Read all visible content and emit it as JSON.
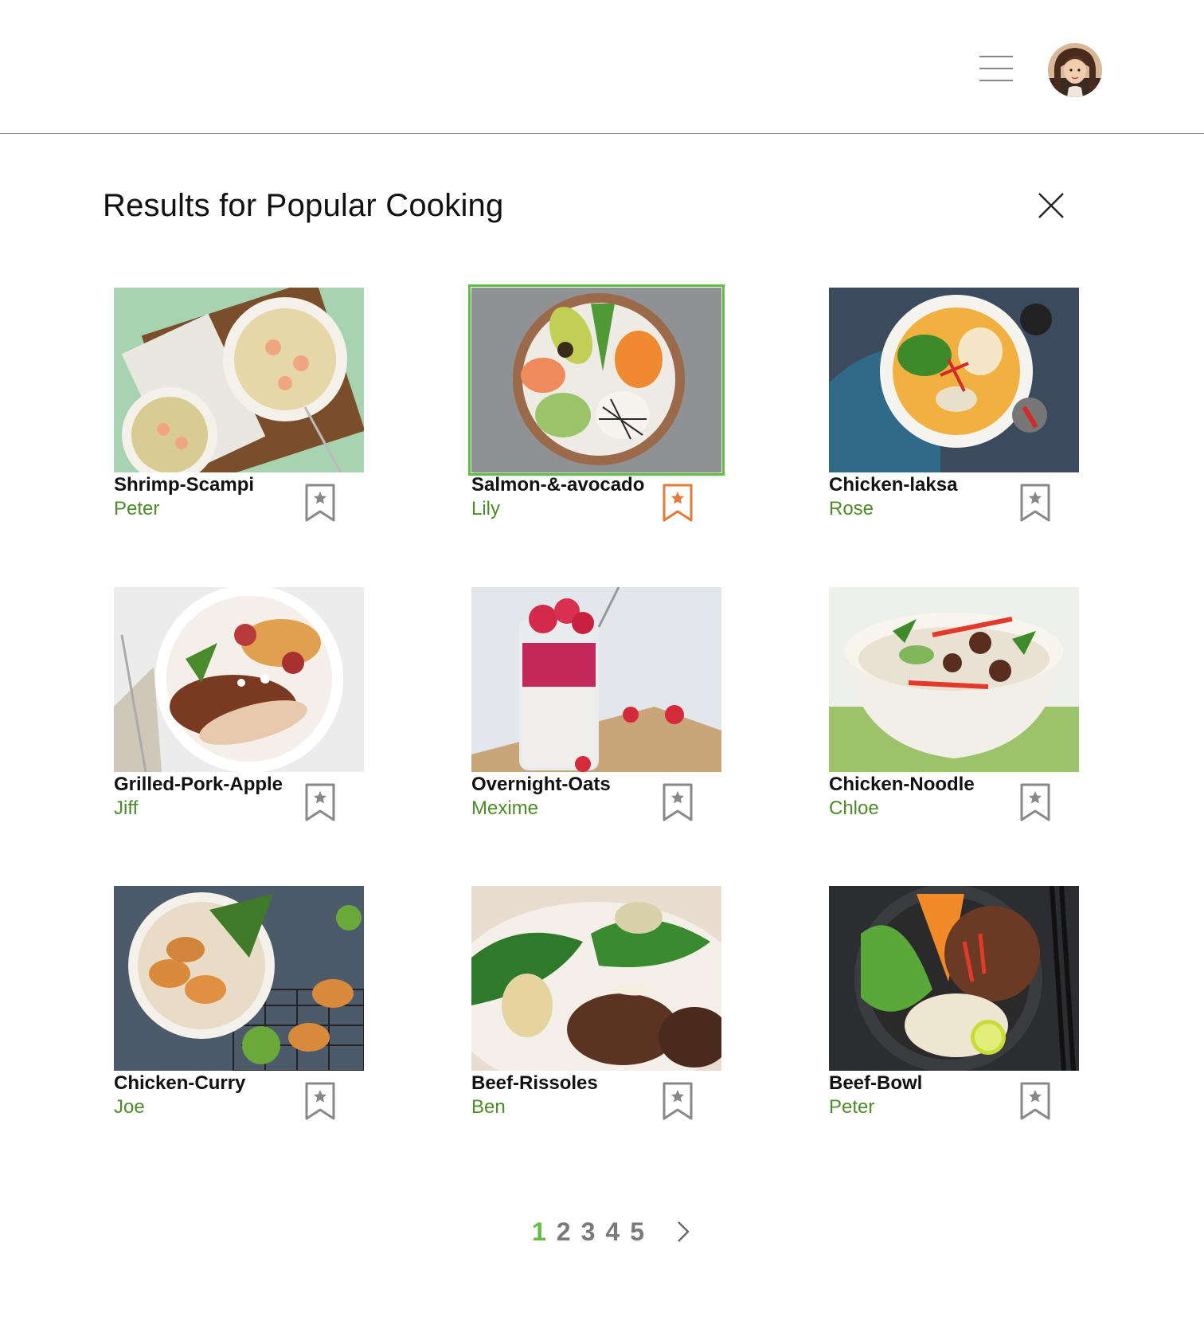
{
  "header": {
    "menu_icon": "hamburger-menu-icon",
    "avatar_icon": "user-avatar"
  },
  "page": {
    "title": "Results for Popular Cooking",
    "close_icon": "close-icon"
  },
  "colors": {
    "accent_green": "#63bd45",
    "author_green": "#4f8a2a",
    "bookmark_active": "#e07b39",
    "bookmark_default": "#888888"
  },
  "recipes": [
    {
      "title": "Shrimp-Scampi",
      "author": "Peter",
      "bookmarked": false,
      "selected": false
    },
    {
      "title": "Salmon-&-avocado",
      "author": "Lily",
      "bookmarked": true,
      "selected": true
    },
    {
      "title": "Chicken-laksa",
      "author": "Rose",
      "bookmarked": false,
      "selected": false
    },
    {
      "title": "Grilled-Pork-Apple",
      "author": "Jiff",
      "bookmarked": false,
      "selected": false
    },
    {
      "title": "Overnight-Oats",
      "author": "Mexime",
      "bookmarked": false,
      "selected": false
    },
    {
      "title": "Chicken-Noodle",
      "author": "Chloe",
      "bookmarked": false,
      "selected": false
    },
    {
      "title": "Chicken-Curry",
      "author": "Joe",
      "bookmarked": false,
      "selected": false
    },
    {
      "title": "Beef-Rissoles",
      "author": "Ben",
      "bookmarked": false,
      "selected": false
    },
    {
      "title": "Beef-Bowl",
      "author": "Peter",
      "bookmarked": false,
      "selected": false
    }
  ],
  "pagination": {
    "pages": [
      "1",
      "2",
      "3",
      "4",
      "5"
    ],
    "current": "1",
    "next_icon": "chevron-right-icon"
  }
}
